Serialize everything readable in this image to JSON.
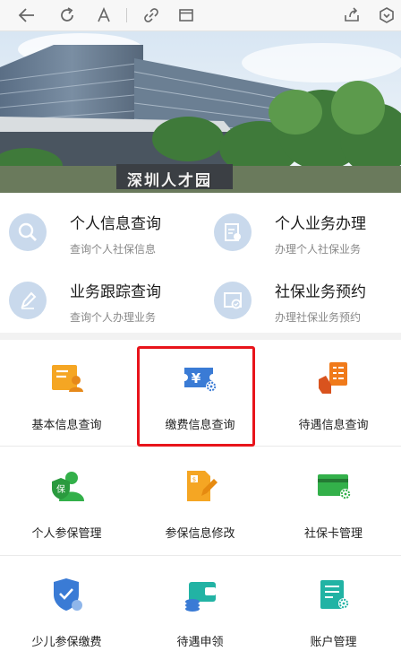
{
  "toolbar": {
    "icons": [
      "back-arrow-icon",
      "refresh-icon",
      "font-size-icon",
      "link-icon",
      "window-icon",
      "share-icon",
      "bookmark-icon"
    ]
  },
  "banner": {
    "sign_text": "深圳人才园"
  },
  "quick_services": [
    {
      "title": "个人信息查询",
      "subtitle": "查询个人社保信息",
      "icon": "search-icon"
    },
    {
      "title": "个人业务办理",
      "subtitle": "办理个人社保业务",
      "icon": "form-star-icon"
    },
    {
      "title": "业务跟踪查询",
      "subtitle": "查询个人办理业务",
      "icon": "pen-icon"
    },
    {
      "title": "社保业务预约",
      "subtitle": "办理社保业务预约",
      "icon": "calendar-check-icon"
    }
  ],
  "grid": [
    {
      "label": "基本信息查询",
      "icon": "profile-card-icon"
    },
    {
      "label": "缴费信息查询",
      "icon": "payment-ticket-icon"
    },
    {
      "label": "待遇信息查询",
      "icon": "hand-checklist-icon"
    },
    {
      "label": "个人参保管理",
      "icon": "insured-person-icon"
    },
    {
      "label": "参保信息修改",
      "icon": "edit-document-icon"
    },
    {
      "label": "社保卡管理",
      "icon": "card-gear-icon"
    },
    {
      "label": "少儿参保缴费",
      "icon": "shield-check-icon"
    },
    {
      "label": "待遇申领",
      "icon": "wallet-coins-icon"
    },
    {
      "label": "账户管理",
      "icon": "account-gear-icon"
    }
  ],
  "colors": {
    "highlight": "#e8141b",
    "orange": "#f5a623",
    "blue": "#3a7bd5",
    "green": "#33b04a",
    "teal": "#22b3a4",
    "quick_icon_bg": "#c9d9ec"
  }
}
